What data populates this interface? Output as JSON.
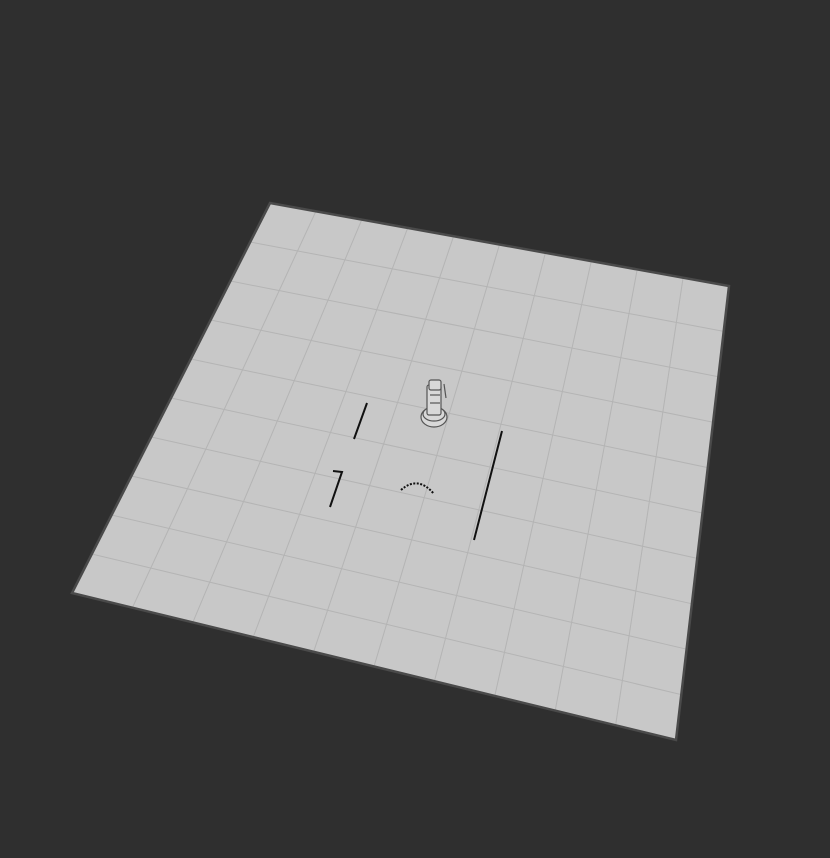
{
  "viewport": {
    "background_color": "#2f2f2f"
  },
  "ground_plane": {
    "fill_color": "#c8c8c8",
    "edge_color": "#4a4a4a",
    "grid_color": "#b4b4b4",
    "grid_divisions": 10
  },
  "robot": {
    "icon": "mobile-robot-icon",
    "body_color": "#d8d8d8",
    "outline_color": "#555555"
  },
  "laser_scan": {
    "point_color": "#111111"
  }
}
